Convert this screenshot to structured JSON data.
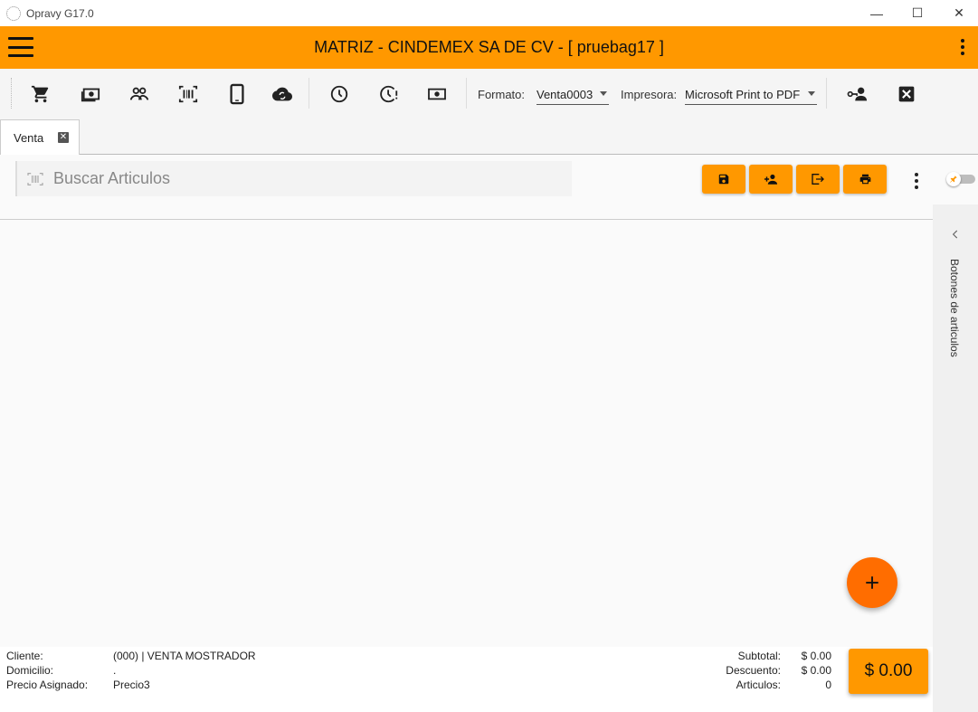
{
  "window": {
    "title": "Opravy G17.0",
    "minimize": "—",
    "maximize": "☐",
    "close": "✕"
  },
  "header": {
    "title": "MATRIZ - CINDEMEX SA DE CV - [ pruebag17 ]",
    "accent": "#ff9800"
  },
  "toolbar": {
    "icons": [
      "cart-icon",
      "cash-icon",
      "people-icon",
      "barcode-icon",
      "tablet-icon",
      "cloud-sync-icon",
      "clock-icon",
      "clock-alert-icon",
      "money-icon",
      "user-key-icon",
      "close-box-icon"
    ],
    "formato_label": "Formato:",
    "formato_value": "Venta0003",
    "impresora_label": "Impresora:",
    "impresora_value": "Microsoft Print to PDF"
  },
  "tabs": [
    {
      "label": "Venta"
    }
  ],
  "search": {
    "placeholder": "Buscar Articulos"
  },
  "actions": [
    "save-icon",
    "add-user-icon",
    "exit-icon",
    "print-icon"
  ],
  "side_panel": {
    "label": "Botones de articulos"
  },
  "footer": {
    "cliente_label": "Cliente:",
    "cliente_value": "(000) | VENTA MOSTRADOR",
    "domicilio_label": "Domicilio:",
    "domicilio_value": ".",
    "precio_label": "Precio Asignado:",
    "precio_value": "Precio3",
    "subtotal_label": "Subtotal:",
    "subtotal_value": "$ 0.00",
    "descuento_label": "Descuento:",
    "descuento_value": "$ 0.00",
    "articulos_label": "Articulos:",
    "articulos_value": "0",
    "total": "$ 0.00"
  },
  "fab": {
    "symbol": "+",
    "color": "#ff6d00"
  }
}
